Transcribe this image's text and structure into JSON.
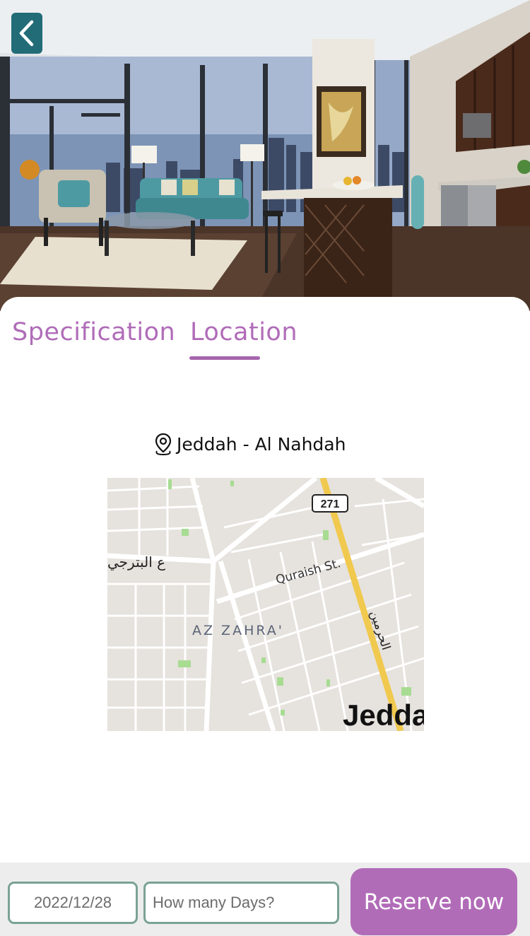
{
  "tabs": {
    "specification": "Specification",
    "location": "Location"
  },
  "location": {
    "name": "Jeddah - Al Nahdah"
  },
  "map": {
    "route_shield": "271",
    "street_label": "Quraish St.",
    "district_label": "AZ ZAHRA'",
    "arabic_label_left": "ع البترجي",
    "arabic_label_road": "الحرمين",
    "city_label": "Jedda"
  },
  "booking": {
    "date_value": "2022/12/28",
    "days_placeholder": "How many Days?",
    "reserve_label": "Reserve now"
  },
  "colors": {
    "accent_purple": "#b06cb8",
    "back_button_teal": "#226c78",
    "field_border": "#7aa294"
  }
}
